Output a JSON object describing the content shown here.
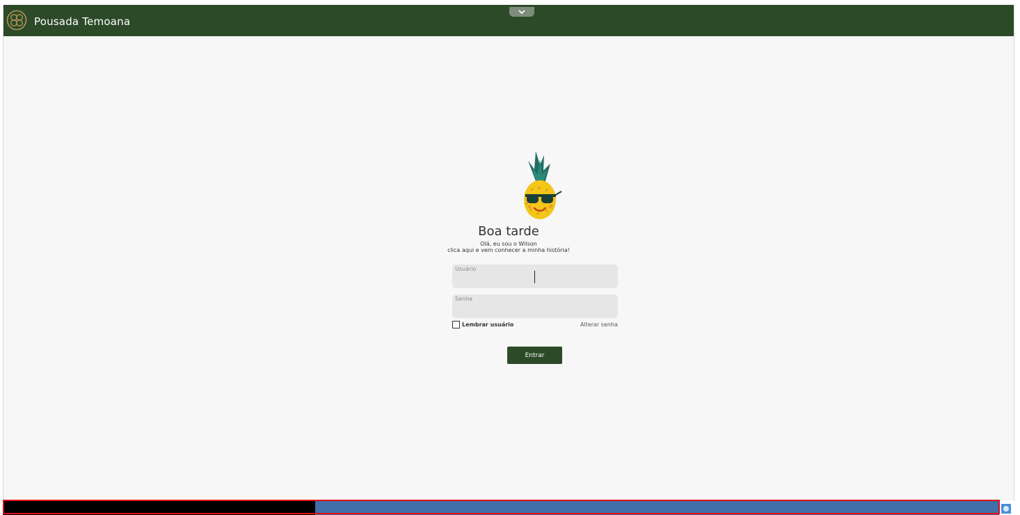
{
  "header": {
    "brand_name": "Pousada Temoana",
    "logo_icon": "knot-logo-icon",
    "collapse_icon": "chevron-down-icon",
    "background_color": "#2c4a28"
  },
  "login": {
    "greeting": "Boa tarde",
    "intro_line1": "Olá, eu sou o Wilson",
    "intro_line2": "clica aqui e vem conhecer a minha história!",
    "username_label": "Usuário",
    "username_value": "",
    "password_label": "Senha",
    "password_value": "",
    "remember_label": "Lembrar usuário",
    "remember_checked": false,
    "change_password_label": "Alterar senha",
    "submit_label": "Entrar",
    "mascot_icon": "pineapple-sunglasses-icon"
  },
  "taskbar": {
    "black_segment_color": "#000000",
    "blue_segment_color": "#3f6ea8",
    "highlight_color": "#e01010",
    "tray_icon": "app-tray-icon"
  }
}
